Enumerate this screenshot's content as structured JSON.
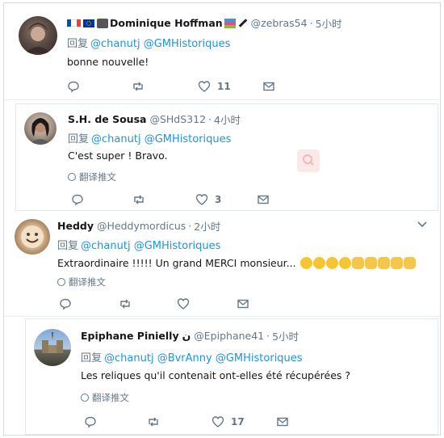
{
  "tweets": [
    {
      "name": "Dominique Hoffman",
      "handle": "@zebras54",
      "time": "5小时",
      "reply_prefix": "回复",
      "mentions": "@chanutj @GMHistoriques",
      "text": "bonne nouvelle!",
      "like_count": "11"
    },
    {
      "name": "S.H. de Sousa",
      "handle": "@SHdS312",
      "time": "4小时",
      "reply_prefix": "回复",
      "mentions": "@chanutj @GMHistoriques",
      "text": "C'est super ! Bravo.",
      "translate": "翻译推文",
      "like_count": "3"
    },
    {
      "name": "Heddy",
      "handle": "@Heddymordicus",
      "time": "2小时",
      "reply_prefix": "回复",
      "mentions": "@chanutj @GMHistoriques",
      "text": "Extraordinaire !!!!! Un grand MERCI monsieur...",
      "translate": "翻译推文",
      "like_count": ""
    },
    {
      "name": "Epiphane Pinielly",
      "name_suffix": "ن",
      "handle": "@Epiphane41",
      "time": "5小时",
      "reply_prefix": "回复",
      "mentions": "@chanutj @BvrAnny @GMHistoriques",
      "text": "Les reliques qu'il contenait ont-elles été récupérées ?",
      "translate": "翻译推文",
      "like_count": "17"
    }
  ],
  "separator": "·",
  "colors": {
    "link": "#1b95e0",
    "muted": "#657786",
    "text": "#14171a",
    "border": "#e6ecf0"
  },
  "icons": [
    "reply-icon",
    "retweet-icon",
    "like-icon",
    "message-icon",
    "globe-icon",
    "chevron-down-icon"
  ]
}
